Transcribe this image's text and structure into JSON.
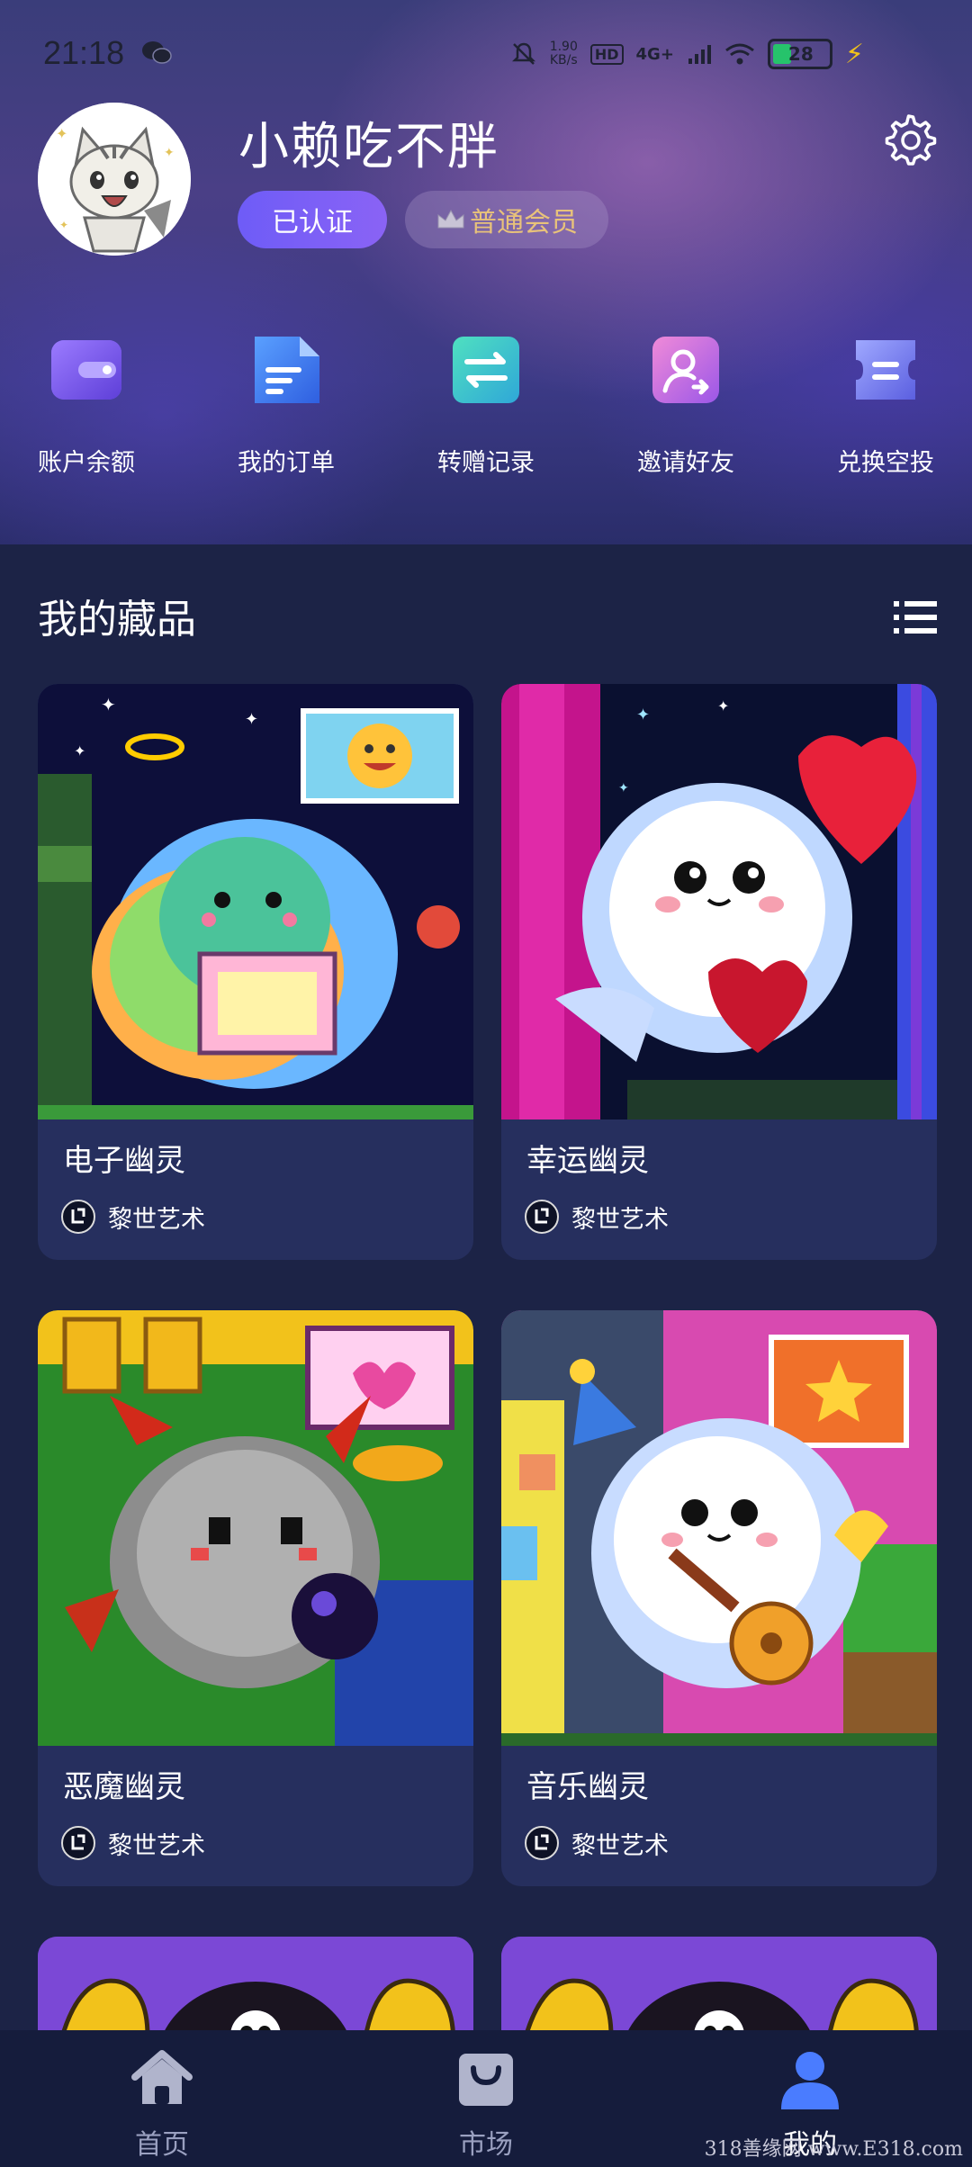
{
  "status_bar": {
    "time": "21:18",
    "net_speed_value": "1.90",
    "net_speed_unit": "KB/s",
    "hd": "HD",
    "network": "4G+",
    "battery": "28"
  },
  "profile": {
    "username": "小赖吃不胖",
    "verified_label": "已认证",
    "member_label": "普通会员"
  },
  "quick_menu": [
    {
      "label": "账户余额",
      "icon": "wallet-icon"
    },
    {
      "label": "我的订单",
      "icon": "document-icon"
    },
    {
      "label": "转赠记录",
      "icon": "transfer-icon"
    },
    {
      "label": "邀请好友",
      "icon": "invite-user-icon"
    },
    {
      "label": "兑换空投",
      "icon": "redeem-icon"
    }
  ],
  "collection": {
    "title": "我的藏品",
    "items": [
      {
        "name": "电子幽灵",
        "creator": "黎世艺术"
      },
      {
        "name": "幸运幽灵",
        "creator": "黎世艺术"
      },
      {
        "name": "恶魔幽灵",
        "creator": "黎世艺术"
      },
      {
        "name": "音乐幽灵",
        "creator": "黎世艺术"
      }
    ]
  },
  "tabbar": [
    {
      "label": "首页",
      "icon": "home-icon",
      "active": false
    },
    {
      "label": "市场",
      "icon": "shopping-bag-icon",
      "active": false
    },
    {
      "label": "我的",
      "icon": "user-icon",
      "active": true
    }
  ],
  "watermark": "318善缘网  www.E318.com",
  "colors": {
    "background": "#1c2346",
    "card": "#262f5e",
    "accent": "#6e5cf7",
    "member_gold": "#e8c27a"
  }
}
